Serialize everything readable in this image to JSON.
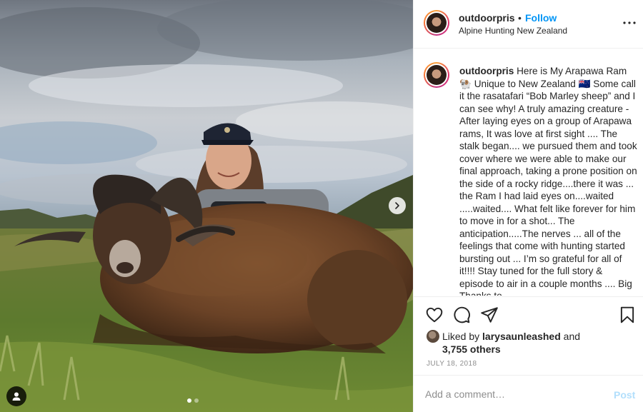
{
  "post": {
    "username": "outdoorpris",
    "separator": "•",
    "follow_label": "Follow",
    "location": "Alpine Hunting New Zealand",
    "caption_username": "outdoorpris",
    "caption_text": "Here is My Arapawa Ram 🐏 Unique to New Zealand 🇳🇿 Some call it the rasatafari “Bob Marley sheep” and I can see why! A truly amazing creature - After laying eyes on a group of Arapawa rams, It was love at first sight .... The stalk began.... we pursued them and took cover where we were able to make our final approach, taking a prone position on the side of a rocky ridge....there it was ... the Ram I had laid eyes on....waited .....waited.... What felt like forever for him to move in for a shot... The anticipation.....The nerves ... all of the feelings that come with hunting started bursting out ... I’m so grateful for all of it!!!! Stay tuned for the full story & episode to air in a couple months .... Big Thanks to",
    "liked_prefix": "Liked by ",
    "liked_user": "larysaunleashed",
    "liked_and": " and",
    "liked_others": "3,755 others",
    "date": "JULY 18, 2018"
  },
  "comment": {
    "placeholder": "Add a comment…",
    "post_label": "Post"
  },
  "carousel": {
    "slide_count": 2,
    "active_index": 0
  },
  "icons": {
    "more": "more-options-icon",
    "like": "heart-icon",
    "comment": "comment-icon",
    "share": "share-icon",
    "save": "bookmark-icon",
    "next": "chevron-right-icon",
    "tag": "user-tag-icon"
  },
  "colors": {
    "link": "#0095f6",
    "post_disabled": "#b2dffc",
    "secondary_text": "#8e8e8e",
    "primary_text": "#262626"
  }
}
